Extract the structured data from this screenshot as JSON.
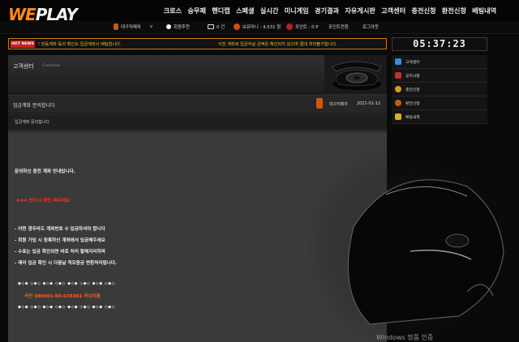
{
  "logo": {
    "we": "WE",
    "play": "PLAY"
  },
  "nav": [
    "크로스",
    "승무패",
    "핸디캡",
    "스페셜",
    "실시간",
    "미니게임",
    "경기결과",
    "자유게시판",
    "고객센터",
    "충전신청",
    "환전신청",
    "베팅내역"
  ],
  "userbar": {
    "username": "대구저메차",
    "username_suffix": "v",
    "attendance": "회원추천",
    "messages_count": "0 건",
    "money_label": "보유머니 : 4,531 원",
    "point_label": "포인트 : 0 P",
    "point_convert": "포인트전환",
    "logout": "로그아웃"
  },
  "ticker": {
    "badge": "HOT NEWS",
    "text1": "! 한동계좌 등의 확인도 입금계좌시 베팅합니다.",
    "text2": "이전 계좌로 입금하실 금액은 확인되지 않으며 절대 처리불가합니다."
  },
  "clock": "05:37:23",
  "panel": {
    "title": "고객센터",
    "subtitle": "Customer"
  },
  "message": {
    "title": "입금계좌 문의합니다",
    "author": "대구저메차",
    "date": "2021-01-12",
    "subject": "입금계좌 문의합니다",
    "lines": {
      "l1": "문의하신 충전 계좌 안내입니다.",
      "l2": "### 반드시 확인 해주세요",
      "l3": "- 어떤 경우라도 계좌번호 수 입금하셔야 합니다",
      "l4": "- 회원 가입 시 등록하신 계좌에서 입금해주세요",
      "l5": "- 수표는 입금 확인되면 바로 처리 할해지리하며",
      "l6": "- 재리 입금 확인 시 다음날 적모응금 변환처리됩니다.",
      "deco1": "◆◇◆ ◇◆◇ ◆◇◆ ◇◆◇ ◆◇◆ ◇◆◇ ◆◇◆ ◇◆◇",
      "account": "국민 989801-00-038381 카오이롱",
      "deco2": "◆◇◆ ◇◆◇ ◆◇◆ ◇◆◇ ◆◇◆ ◇◆◇ ◆◇◆ ◇◆◇"
    }
  },
  "side_menu": [
    {
      "label": "고객센터",
      "icon": "headset-icon",
      "color": "#3a8bd8"
    },
    {
      "label": "공지사항",
      "icon": "megaphone-icon",
      "color": "#c03030"
    },
    {
      "label": "충전신청",
      "icon": "coin-icon",
      "color": "#d89a1a"
    },
    {
      "label": "환전신청",
      "icon": "exchange-icon",
      "color": "#c0601a"
    },
    {
      "label": "배팅내역",
      "icon": "list-icon",
      "color": "#d8b21a"
    }
  ],
  "watermark": "Windows 정품 인증"
}
